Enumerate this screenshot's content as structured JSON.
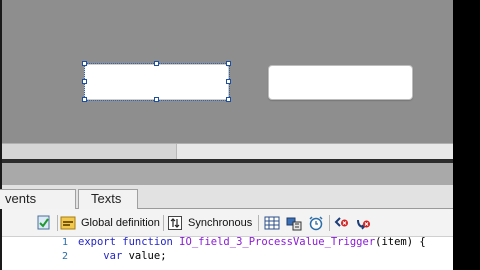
{
  "tabs": [
    {
      "label": "vents"
    },
    {
      "label": "Texts"
    }
  ],
  "toolbar": {
    "global_definition_label": "Global definition",
    "synchronous_label": "Synchronous"
  },
  "editor": {
    "lines": [
      {
        "number": "1",
        "tokens": {
          "kw1": "export",
          "kw2": "function",
          "name": "IO_field_3_ProcessValue_Trigger",
          "rest": "(item) {"
        }
      },
      {
        "number": "2",
        "tokens": {
          "indent": "    ",
          "kw": "var",
          "rest": " value;"
        }
      }
    ]
  },
  "colors": {
    "canvas": "#8e8e8e",
    "keyword": "#2426c8",
    "function_name": "#8c1ad8",
    "selection": "#1d4f9e"
  }
}
